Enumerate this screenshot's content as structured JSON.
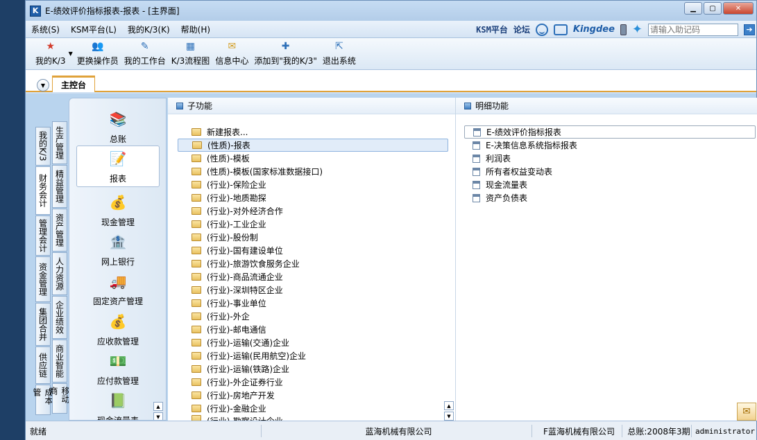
{
  "window": {
    "title": "E-绩效评价指标报表-报表 - [主界面]",
    "icon_label": "K"
  },
  "menubar": {
    "items": [
      "系统(S)",
      "KSM平台(L)",
      "我的K/3(K)",
      "帮助(H)"
    ],
    "ksm_link": "KSM平台",
    "forum_link": "论坛",
    "brand": "Kingdee",
    "helpcode_placeholder": "请输入助记码"
  },
  "toolbar": {
    "buttons": [
      {
        "label": "我的K/3",
        "icon": "star-icon"
      },
      {
        "label": "更换操作员",
        "icon": "user-switch-icon"
      },
      {
        "label": "我的工作台",
        "icon": "pen-icon"
      },
      {
        "label": "K/3流程图",
        "icon": "flowchart-icon"
      },
      {
        "label": "信息中心",
        "icon": "message-icon"
      },
      {
        "label": "添加到\"我的K/3\"",
        "icon": "add-favorite-icon"
      },
      {
        "label": "退出系统",
        "icon": "exit-icon"
      }
    ]
  },
  "tabs": {
    "main_tab": "主控台"
  },
  "left_tabs": [
    "我的K/3",
    "财务会计",
    "管理会计",
    "资金管理",
    "集团合并",
    "供应链",
    "成本管"
  ],
  "right_tabs": [
    "生产管理",
    "精益管理",
    "资产管理",
    "人力资源",
    "企业绩效",
    "商业智能",
    "移动商"
  ],
  "modules": [
    {
      "label": "总账",
      "icon": "ledger-icon",
      "glyph": "📚"
    },
    {
      "label": "报表",
      "icon": "report-icon",
      "glyph": "📝"
    },
    {
      "label": "现金管理",
      "icon": "cash-icon",
      "glyph": "💰"
    },
    {
      "label": "网上银行",
      "icon": "bank-icon",
      "glyph": "🏦"
    },
    {
      "label": "固定资产管理",
      "icon": "truck-icon",
      "glyph": "🚚"
    },
    {
      "label": "应收款管理",
      "icon": "receivable-icon",
      "glyph": "💰"
    },
    {
      "label": "应付款管理",
      "icon": "payable-icon",
      "glyph": "💵"
    },
    {
      "label": "现金流量表",
      "icon": "cashflow-icon",
      "glyph": "📗"
    }
  ],
  "sub_panel": {
    "header": "子功能",
    "items": [
      "新建报表...",
      "(性质)-报表",
      "(性质)-模板",
      "(性质)-模板(国家标准数据接口)",
      "(行业)-保险企业",
      "(行业)-地质勘探",
      "(行业)-对外经济合作",
      "(行业)-工业企业",
      "(行业)-股份制",
      "(行业)-国有建设单位",
      "(行业)-旅游饮食服务企业",
      "(行业)-商品流通企业",
      "(行业)-深圳特区企业",
      "(行业)-事业单位",
      "(行业)-外企",
      "(行业)-邮电通信",
      "(行业)-运输(交通)企业",
      "(行业)-运输(民用航空)企业",
      "(行业)-运输(铁路)企业",
      "(行业)-外企证券行业",
      "(行业)-房地产开发",
      "(行业)-金融企业",
      "(行业)-勘察设计企业"
    ],
    "selected_index": 1
  },
  "detail_panel": {
    "header": "明细功能",
    "items": [
      "E-绩效评价指标报表",
      "E-决策信息系统指标报表",
      "利润表",
      "所有者权益变动表",
      "现金流量表",
      "资产负债表"
    ],
    "selected_index": 0
  },
  "statusbar": {
    "status": "就绪",
    "company": "蓝海机械有限公司",
    "account": "F蓝海机械有限公司",
    "period": "总账:2008年3期",
    "user": "administrator"
  }
}
